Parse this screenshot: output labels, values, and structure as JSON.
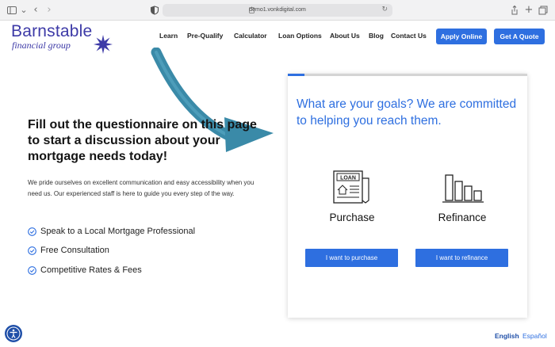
{
  "browser": {
    "url": "demo1.vonkdigital.com",
    "icons": [
      "sidebar-icon",
      "chevron-down-icon",
      "back-icon",
      "forward-icon",
      "shield-icon",
      "reload-icon",
      "share-icon",
      "new-tab-icon",
      "tabs-icon"
    ]
  },
  "logo": {
    "name": "Barnstable",
    "tagline": "financial group"
  },
  "nav": {
    "items": [
      "Learn",
      "Pre-Qualify",
      "Calculator",
      "Loan Options",
      "About Us",
      "Blog",
      "Contact Us"
    ],
    "apply_label": "Apply Online",
    "quote_label": "Get A Quote"
  },
  "hero": {
    "headline": "Fill out the questionnaire on this page to start a discussion about your mortgage needs today!",
    "intro": "We pride ourselves on excellent communication and easy accessibility when you need us. Our experienced staff is here to guide you every step of the way.",
    "features": [
      "Speak to a Local Mortgage Professional",
      "Free Consultation",
      "Competitive Rates & Fees"
    ]
  },
  "questionnaire": {
    "progress": 0.07,
    "heading": "What are your goals? We are committed to helping you reach them.",
    "options": [
      {
        "icon": "loan-document-icon",
        "icon_text": "LOAN",
        "label": "Purchase",
        "button": "I want to purchase"
      },
      {
        "icon": "bar-chart-icon",
        "label": "Refinance",
        "button": "I want to refinance"
      }
    ]
  },
  "language": {
    "english": "English",
    "spanish": "Español"
  },
  "colors": {
    "brand": "#3d3aa7",
    "accent": "#2e6fe0",
    "arrow": "#3a8aa8"
  }
}
